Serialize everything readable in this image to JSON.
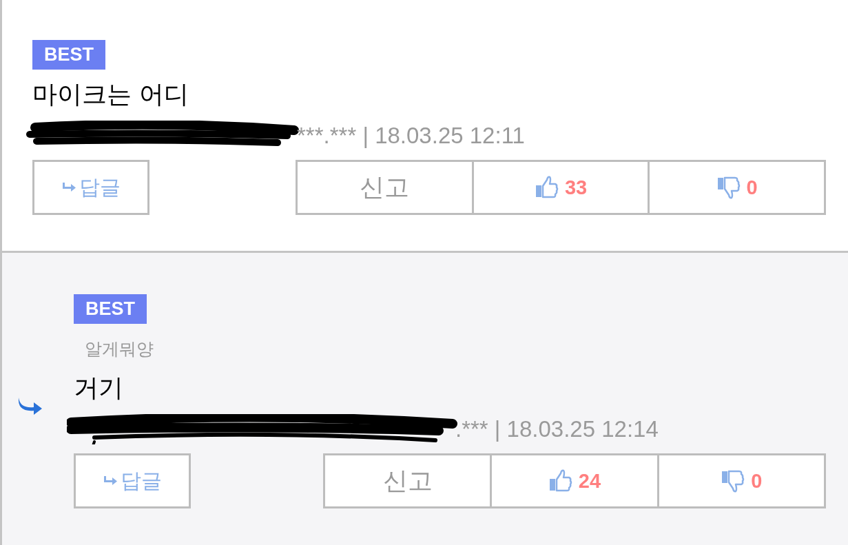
{
  "comments": [
    {
      "badge": "BEST",
      "is_reply": false,
      "text": "마이크는 어디",
      "meta": "***.*** | 18.03.25 12:11",
      "reply_label": "답글",
      "report_label": "신고",
      "likes": "33",
      "dislikes": "0"
    },
    {
      "badge": "BEST",
      "is_reply": true,
      "author": "알게뭐양",
      "text": "거기",
      "meta": ".*** | 18.03.25 12:14",
      "reply_label": "답글",
      "report_label": "신고",
      "likes": "24",
      "dislikes": "0"
    }
  ]
}
